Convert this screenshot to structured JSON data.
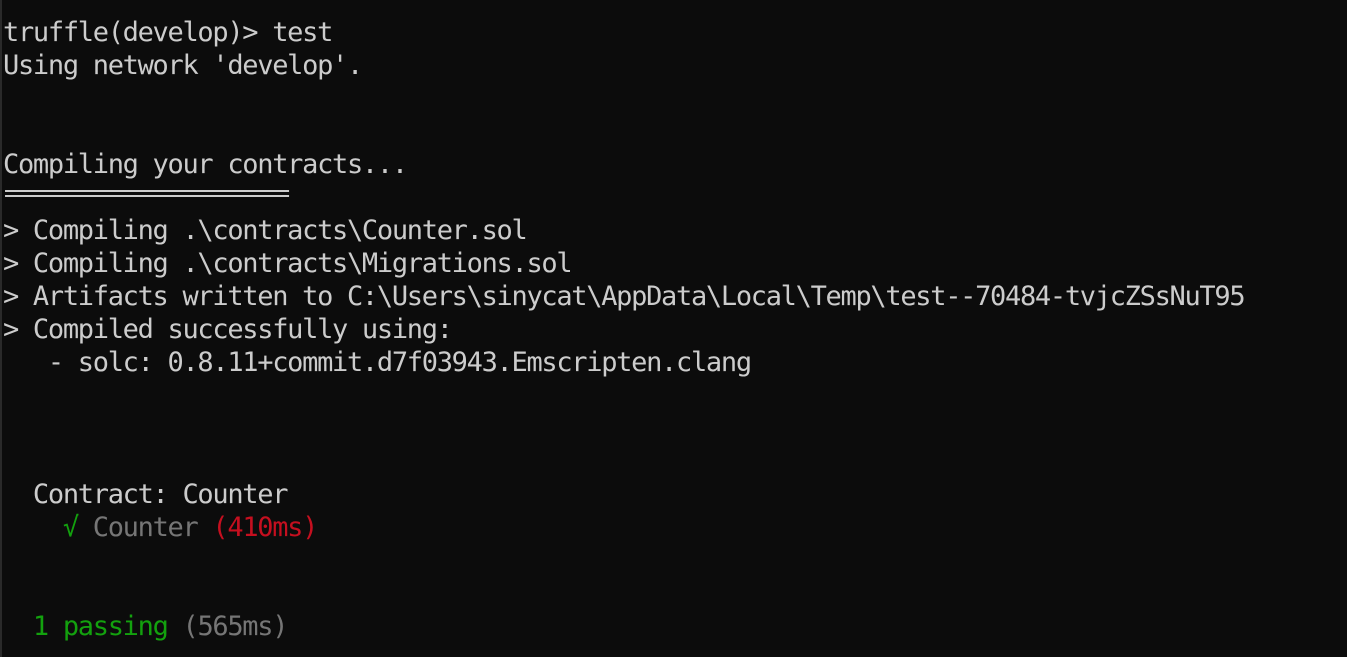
{
  "terminal": {
    "prompt_line": "truffle(develop)> test",
    "network_line": "Using network 'develop'.",
    "compiling_header": "Compiling your contracts...",
    "rule": "===========================",
    "compile_lines": [
      "> Compiling .\\contracts\\Counter.sol",
      "> Compiling .\\contracts\\Migrations.sol",
      "> Artifacts written to C:\\Users\\sinycat\\AppData\\Local\\Temp\\test--70484-tvjcZSsNuT95",
      "> Compiled successfully using:",
      "   - solc: 0.8.11+commit.d7f03943.Emscripten.clang"
    ],
    "contract_line": "  Contract: Counter",
    "test_result": {
      "indent": "    ",
      "check": "√",
      "name": " Counter ",
      "duration": "(410ms)"
    },
    "summary": {
      "indent": "  ",
      "count": "1 passing",
      "duration": " (565ms)"
    }
  },
  "colors": {
    "background": "#0c0c0c",
    "text": "#cccccc",
    "pass": "#13a10e",
    "slow": "#c50f1f",
    "muted": "#767676"
  }
}
